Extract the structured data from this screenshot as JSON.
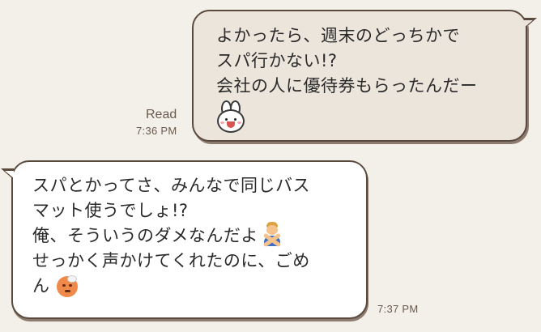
{
  "outgoing": {
    "lines": [
      "よかったら、週末のどっちかで",
      "スパ行かない!?",
      "会社の人に優待券もらったんだー"
    ],
    "sticker": "bunny-emoji",
    "read_label": "Read",
    "time": "7:36 PM"
  },
  "incoming": {
    "lines": [
      "スパとかってさ、みんなで同じバス",
      "マット使うでしょ!?",
      "俺、そういうのダメなんだよ",
      "せっかく声かけてくれたのに、ごめ",
      "ん"
    ],
    "emoji_after_line_3": "person-gesturing-no-emoji",
    "emoji_after_line_5": "hot-face-emoji",
    "time": "7:37 PM"
  },
  "colors": {
    "background": "#f3efe9",
    "outgoing_bubble": "#ece5dc",
    "incoming_bubble": "#ffffff",
    "border": "#5a4a3e",
    "meta_text": "#6a5a4e"
  }
}
